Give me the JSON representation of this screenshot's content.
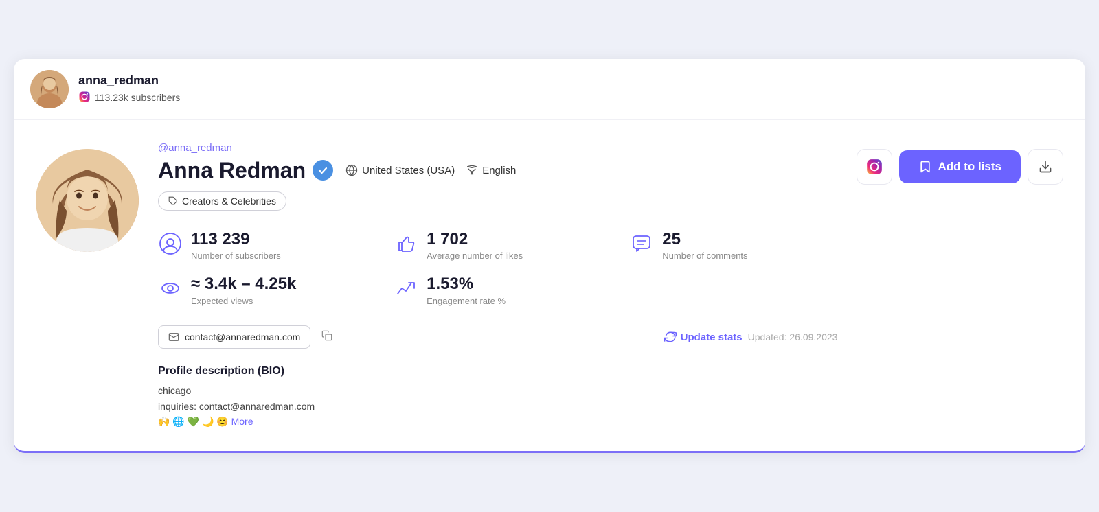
{
  "header": {
    "username": "anna_redman",
    "subscribers": "113.23k subscribers",
    "avatar_emoji": "👩"
  },
  "profile": {
    "handle": "@anna_redman",
    "name": "Anna Redman",
    "verified": true,
    "location": "United States (USA)",
    "language": "English",
    "category": "Creators & Celebrities",
    "avatar_emoji": "👩"
  },
  "stats": {
    "subscribers_value": "113 239",
    "subscribers_label": "Number of subscribers",
    "likes_value": "1 702",
    "likes_label": "Average number of likes",
    "comments_value": "25",
    "comments_label": "Number of comments",
    "views_value": "≈ 3.4k – 4.25k",
    "views_label": "Expected views",
    "engagement_value": "1.53%",
    "engagement_label": "Engagement rate %"
  },
  "contact": {
    "email": "contact@annaredman.com",
    "update_label": "Update stats",
    "updated_text": "Updated: 26.09.2023"
  },
  "bio": {
    "title": "Profile description (BIO)",
    "lines": [
      "chicago",
      "inquiries: contact@annaredman.com"
    ],
    "emojis": "🙌🌐💚🌙😊",
    "more_label": "More"
  },
  "actions": {
    "add_to_lists_label": "Add to lists"
  },
  "colors": {
    "accent": "#6c63ff",
    "verified_blue": "#4a90e2"
  }
}
